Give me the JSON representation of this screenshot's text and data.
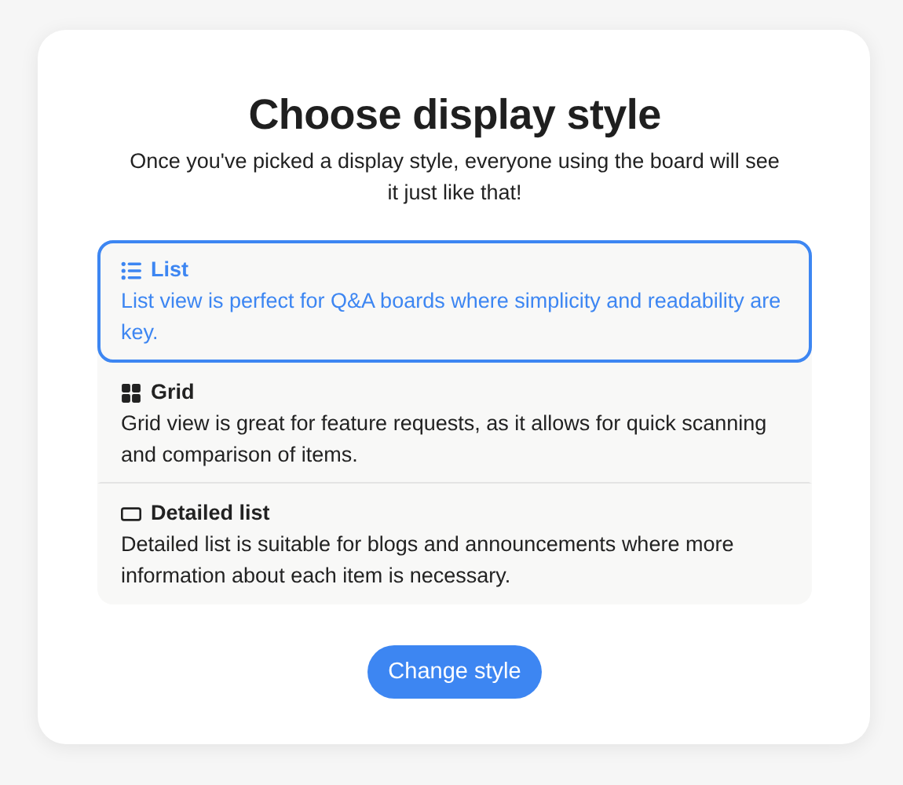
{
  "title": "Choose display style",
  "subtitle": "Once you've picked a display style, everyone using the board will see it just like that!",
  "options": [
    {
      "kind": "list",
      "label": "List",
      "description": "List view is perfect for Q&A boards where simplicity and readability are key.",
      "selected": true
    },
    {
      "kind": "grid",
      "label": "Grid",
      "description": "Grid view is great for feature requests, as it allows for quick scanning and comparison of items.",
      "selected": false
    },
    {
      "kind": "detailed",
      "label": "Detailed list",
      "description": "Detailed list is suitable for blogs and announcements where more information about each item is necessary.",
      "selected": false
    }
  ],
  "button": "Change style"
}
